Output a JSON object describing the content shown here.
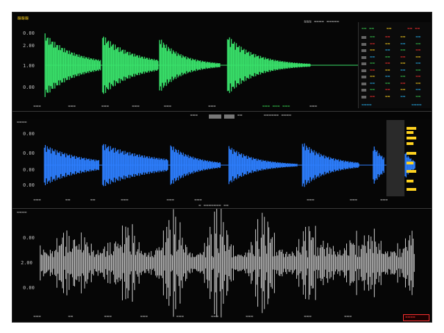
{
  "app": {
    "logo_text": "≋≋≋",
    "top_right_text": "≋≋≋ ≈≈≈≈ ≈≈≈≈≈"
  },
  "colors": {
    "green": "#39e36b",
    "blue": "#2d7fff",
    "white": "#e6e6e6",
    "yellow": "#ffd21f",
    "red": "#ff3030",
    "cyan": "#29b6f6"
  },
  "panel1": {
    "y_ticks": [
      "0.00",
      "2.00",
      "1.00",
      "0.00"
    ],
    "x_ticks": [
      "≈≈≈",
      "≈≈≈",
      "≈≈≈",
      "≈≈≈",
      "≈≈≈",
      "≈≈≈",
      "≈≈≈",
      "≈≈≈",
      "≈≈≈"
    ],
    "status_text": "≈≈≈ ≈≈≈ ≈≈≈"
  },
  "meter": {
    "header": [
      "≈≈ ≈≈",
      "≈≈",
      "≈≈ ≈≈"
    ],
    "rows": [
      {
        "a": "≈≈",
        "b": "≈≈",
        "c": "≈≈",
        "d": "≈≈"
      },
      {
        "a": "≈≈",
        "b": "≈≈",
        "c": "≈≈",
        "d": "≈≈"
      },
      {
        "a": "≈≈",
        "b": "≈≈",
        "c": "≈≈",
        "d": "≈≈"
      },
      {
        "a": "≈≈",
        "b": "≈≈",
        "c": "≈≈",
        "d": "≈≈"
      },
      {
        "a": "≈≈",
        "b": "≈≈",
        "c": "≈≈",
        "d": "≈≈"
      },
      {
        "a": "≈≈",
        "b": "≈≈",
        "c": "≈≈",
        "d": "≈≈"
      },
      {
        "a": "≈≈",
        "b": "≈≈",
        "c": "≈≈",
        "d": "≈≈"
      },
      {
        "a": "≈≈",
        "b": "≈≈",
        "c": "≈≈",
        "d": "≈≈"
      },
      {
        "a": "≈≈",
        "b": "≈≈",
        "c": "≈≈",
        "d": "≈≈"
      },
      {
        "a": "≈≈",
        "b": "≈≈",
        "c": "≈≈",
        "d": "≈≈"
      }
    ],
    "footer_left": "≈≈≈≈",
    "footer_right": "≈≈≈≈"
  },
  "toolbar": {
    "left_text": "≈≈≈",
    "middle_text": "≈≈",
    "right_text": "≈≈≈≈≈≈ ≈≈≈≈"
  },
  "panel2": {
    "header_text": "≈≈≈≈",
    "y_ticks": [
      "0.00",
      "0.00",
      "0.00",
      "0.00"
    ],
    "x_ticks": [
      "≈≈≈",
      "≈≈",
      "≈≈",
      "≈≈≈",
      "≈≈≈",
      "≈≈≈",
      "≈≈≈",
      "≈≈≈",
      "≈≈≈"
    ],
    "footer_text": "≈ ≈≈≈≈≈≈≈ ≈≈"
  },
  "panel3": {
    "header_text": "≈≈≈≈",
    "y_ticks": [
      "0.00",
      "2.00",
      "0.00"
    ],
    "x_ticks": [
      "≈≈≈",
      "≈≈",
      "≈≈≈",
      "≈≈≈",
      "≈≈≈",
      "≈≈≈",
      "≈≈≈",
      "≈≈≈",
      "≈≈≈"
    ],
    "red_badge": "≈≈≈≈"
  }
}
